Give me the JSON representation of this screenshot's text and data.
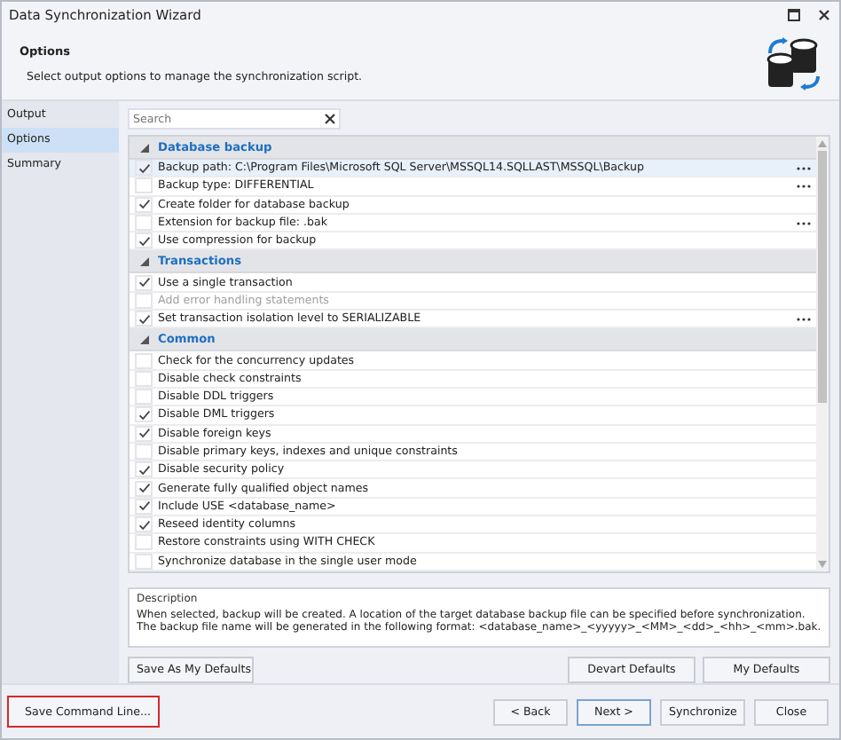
{
  "window": {
    "title": "Data Synchronization Wizard"
  },
  "header": {
    "title": "Options",
    "subtitle": "Select output options to manage the synchronization script."
  },
  "sidebar": {
    "items": [
      {
        "label": "Output",
        "selected": false
      },
      {
        "label": "Options",
        "selected": true
      },
      {
        "label": "Summary",
        "selected": false
      }
    ]
  },
  "search": {
    "placeholder": "Search"
  },
  "groups": [
    {
      "title": "Database backup",
      "expanded": true,
      "items": [
        {
          "label": "Backup path: C:\\Program Files\\Microsoft SQL Server\\MSSQL14.SQLLAST\\MSSQL\\Backup",
          "checked": true,
          "disabled": false,
          "selected": true,
          "browse": true
        },
        {
          "label": "Backup type: DIFFERENTIAL",
          "checked": false,
          "disabled": false,
          "selected": false,
          "browse": true
        },
        {
          "label": "Create folder for database backup",
          "checked": true,
          "disabled": false,
          "selected": false,
          "browse": false
        },
        {
          "label": "Extension for backup file: .bak",
          "checked": false,
          "disabled": false,
          "selected": false,
          "browse": true
        },
        {
          "label": "Use compression for backup",
          "checked": true,
          "disabled": false,
          "selected": false,
          "browse": false
        }
      ]
    },
    {
      "title": "Transactions",
      "expanded": true,
      "items": [
        {
          "label": "Use a single transaction",
          "checked": true,
          "disabled": false,
          "selected": false,
          "browse": false
        },
        {
          "label": "Add error handling statements",
          "checked": false,
          "disabled": true,
          "selected": false,
          "browse": false
        },
        {
          "label": "Set transaction isolation level to SERIALIZABLE",
          "checked": true,
          "disabled": false,
          "selected": false,
          "browse": true
        }
      ]
    },
    {
      "title": "Common",
      "expanded": true,
      "items": [
        {
          "label": "Check for the concurrency updates",
          "checked": false,
          "disabled": false,
          "selected": false,
          "browse": false
        },
        {
          "label": "Disable check constraints",
          "checked": false,
          "disabled": false,
          "selected": false,
          "browse": false
        },
        {
          "label": "Disable DDL triggers",
          "checked": false,
          "disabled": false,
          "selected": false,
          "browse": false
        },
        {
          "label": "Disable DML triggers",
          "checked": true,
          "disabled": false,
          "selected": false,
          "browse": false
        },
        {
          "label": "Disable foreign keys",
          "checked": true,
          "disabled": false,
          "selected": false,
          "browse": false
        },
        {
          "label": "Disable primary keys, indexes and unique constraints",
          "checked": false,
          "disabled": false,
          "selected": false,
          "browse": false
        },
        {
          "label": "Disable security policy",
          "checked": true,
          "disabled": false,
          "selected": false,
          "browse": false
        },
        {
          "label": "Generate fully qualified object names",
          "checked": true,
          "disabled": false,
          "selected": false,
          "browse": false
        },
        {
          "label": "Include USE <database_name>",
          "checked": true,
          "disabled": false,
          "selected": false,
          "browse": false
        },
        {
          "label": "Reseed identity columns",
          "checked": true,
          "disabled": false,
          "selected": false,
          "browse": false
        },
        {
          "label": "Restore constraints using WITH CHECK",
          "checked": false,
          "disabled": false,
          "selected": false,
          "browse": false
        },
        {
          "label": "Synchronize database in the single user mode",
          "checked": false,
          "disabled": false,
          "selected": false,
          "browse": false
        }
      ]
    }
  ],
  "description": {
    "title": "Description",
    "text": "When selected, backup will be created. A location of the target database backup file can be specified before synchronization. The backup file name will be generated in the following format: <database_name>_<yyyyy>_<MM>_<dd>_<hh>_<mm>.bak."
  },
  "defaults_buttons": {
    "left": [
      "Save As My Defaults"
    ],
    "right": [
      "Devart Defaults",
      "My Defaults"
    ]
  },
  "footer": {
    "command_button": {
      "label": "Save Command Line...",
      "highlighted": true
    },
    "buttons": [
      {
        "label": "< Back",
        "default": false
      },
      {
        "label": "Next >",
        "default": true
      },
      {
        "label": "Synchronize",
        "default": false
      },
      {
        "label": "Close",
        "default": false
      }
    ]
  }
}
